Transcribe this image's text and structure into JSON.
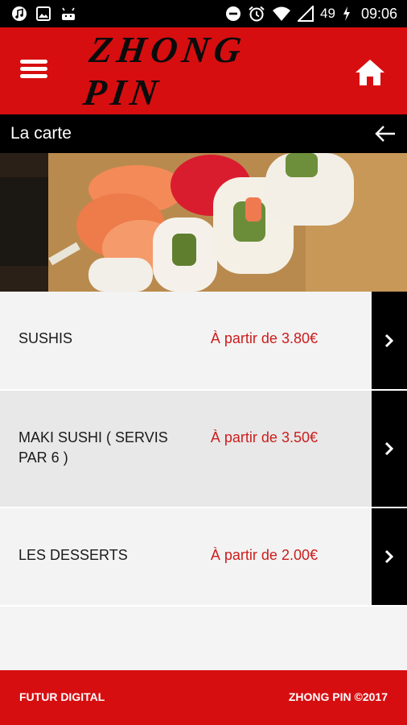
{
  "status_bar": {
    "battery": "49",
    "time": "09:06",
    "icons": [
      "music-icon",
      "image-icon",
      "android-icon",
      "dnd-icon",
      "alarm-icon",
      "wifi-icon",
      "signal-icon",
      "battery-charging-icon"
    ]
  },
  "app_bar": {
    "logo_text": "ZHONG PIN",
    "menu_icon": "hamburger-menu-icon",
    "home_icon": "home-icon"
  },
  "sub_bar": {
    "title": "La carte",
    "back_icon": "arrow-left-icon"
  },
  "categories": [
    {
      "name": "SUSHIS",
      "price": "À partir de 3.80€"
    },
    {
      "name": "MAKI SUSHI ( SERVIS PAR 6 )",
      "price": "À partir de 3.50€"
    },
    {
      "name": "LES DESSERTS",
      "price": "À partir de 2.00€"
    }
  ],
  "footer": {
    "left": "FUTUR DIGITAL",
    "right": "ZHONG PIN ©2017"
  },
  "colors": {
    "brand_red": "#d70e10",
    "price_red": "#cc1d1d",
    "bar_black": "#000000"
  }
}
